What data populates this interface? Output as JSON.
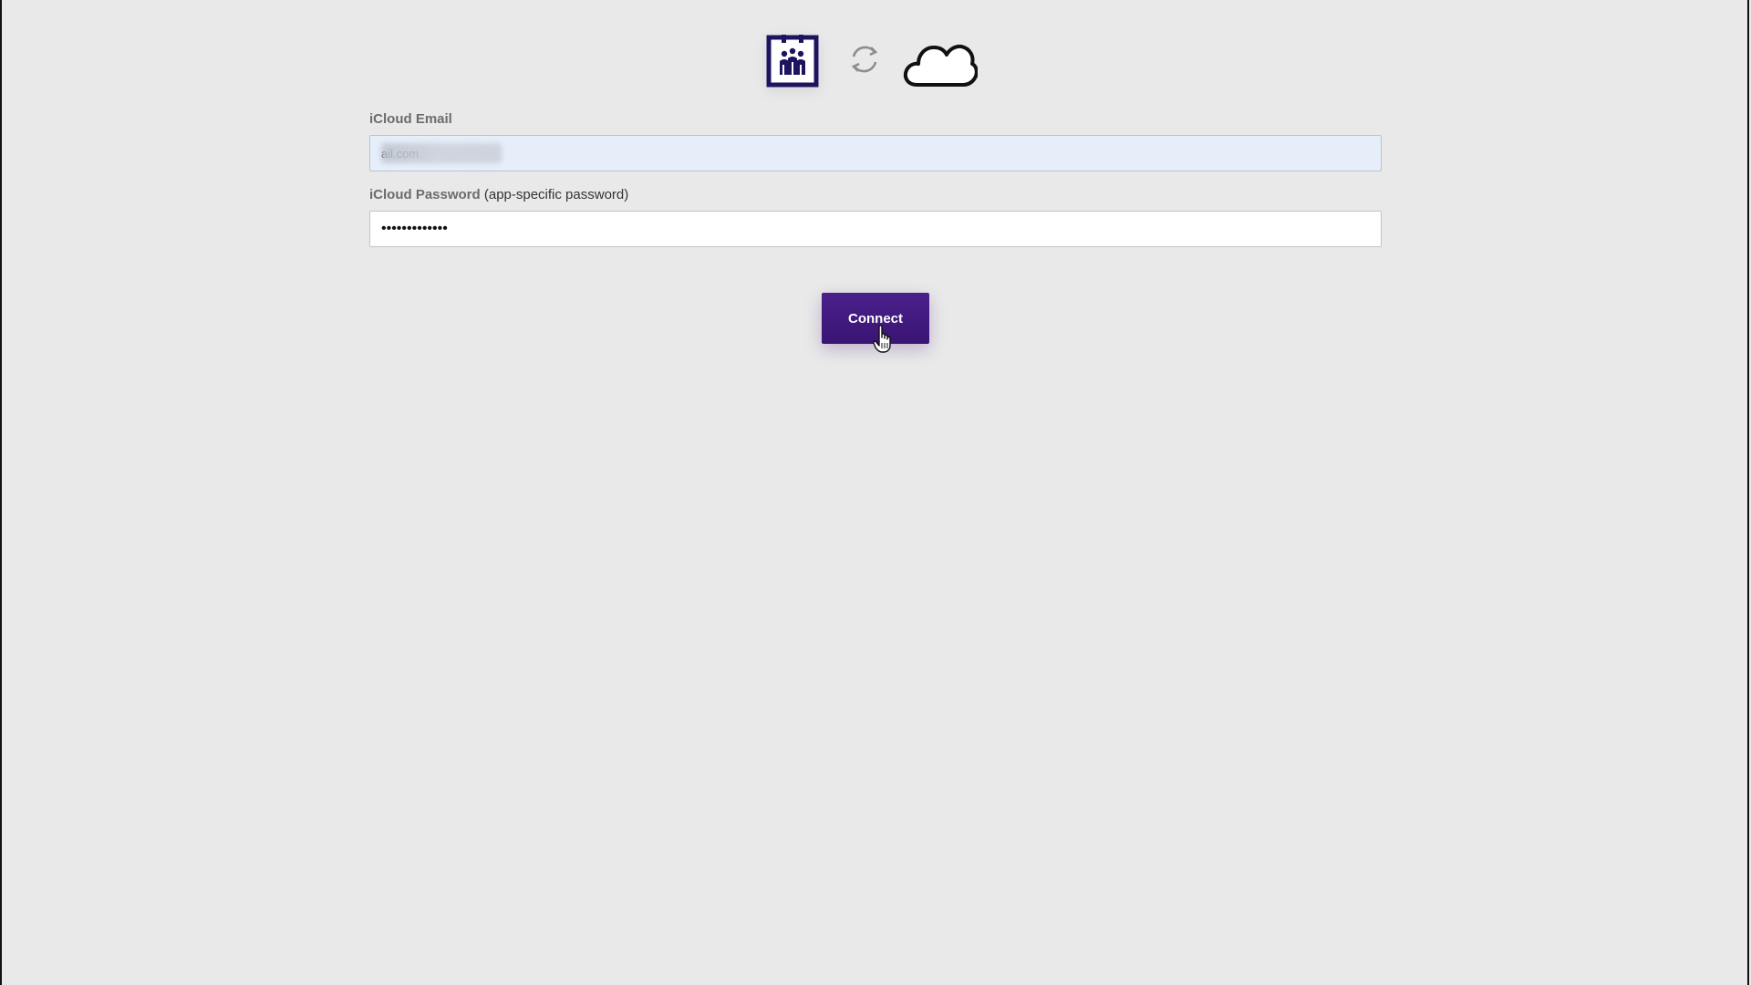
{
  "header": {
    "app_logo": "calendar-people-icon",
    "sync_icon": "sync-arrows-icon",
    "cloud_icon": "cloud-icon"
  },
  "form": {
    "email": {
      "label": "iCloud Email",
      "value": "ail.com"
    },
    "password": {
      "label": "iCloud Password",
      "hint": "(app-specific password)",
      "masked_value": "•••••••••••••"
    },
    "connect_label": "Connect"
  },
  "colors": {
    "brand_purple": "#3d1a78",
    "background": "#e9e9e9",
    "email_field_bg": "#e6eefa"
  }
}
